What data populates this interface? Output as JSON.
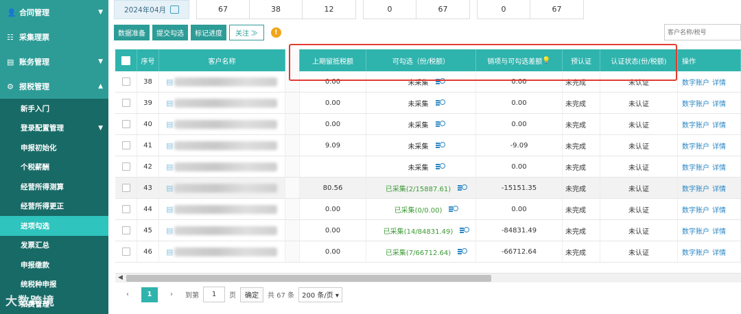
{
  "sidebar": {
    "top_items": [
      {
        "label": "合同管理",
        "icon": "person-icon",
        "chevron": "▼"
      },
      {
        "label": "采集理票",
        "icon": "list-icon",
        "chevron": ""
      },
      {
        "label": "账务管理",
        "icon": "ledger-icon",
        "chevron": "▼"
      },
      {
        "label": "报税管理",
        "icon": "tax-icon",
        "chevron": "▲"
      }
    ],
    "sub_items": [
      {
        "label": "新手入门"
      },
      {
        "label": "登录配置管理",
        "chevron": "▼"
      },
      {
        "label": "申报初始化"
      },
      {
        "label": "个税薪酬"
      },
      {
        "label": "经营所得测算"
      },
      {
        "label": "经营所得更正"
      },
      {
        "label": "进项勾选",
        "active": true
      },
      {
        "label": "发票汇总"
      },
      {
        "label": "申报缴款"
      },
      {
        "label": "统税种申报"
      },
      {
        "label": "扣费管理"
      }
    ],
    "watermark": "大数跨境"
  },
  "stats": {
    "date": "2024年04月",
    "group1": [
      "67",
      "38",
      "12"
    ],
    "group2": [
      "0",
      "67"
    ],
    "group3": [
      "0",
      "67"
    ]
  },
  "toolbar": {
    "buttons": [
      "数据准备",
      "提交勾选",
      "标记进度"
    ],
    "follow_label": "关注 ≫",
    "info": "!"
  },
  "search": {
    "placeholder": "客户名称/税号"
  },
  "table": {
    "headers": [
      "序号",
      "客户名称",
      "上期留抵税额",
      "可勾选（份/税额）",
      "销项与可勾选差额",
      "预认证",
      "认证状态(份/税额)",
      "操作"
    ],
    "rows": [
      {
        "no": "38",
        "prior": "0.00",
        "selectable": "未采集",
        "diff": "0.00",
        "pre": "未完成",
        "status": "未认证",
        "green": false
      },
      {
        "no": "39",
        "prior": "0.00",
        "selectable": "未采集",
        "diff": "0.00",
        "pre": "未完成",
        "status": "未认证",
        "green": false
      },
      {
        "no": "40",
        "prior": "0.00",
        "selectable": "未采集",
        "diff": "0.00",
        "pre": "未完成",
        "status": "未认证",
        "green": false
      },
      {
        "no": "41",
        "prior": "9.09",
        "selectable": "未采集",
        "diff": "-9.09",
        "pre": "未完成",
        "status": "未认证",
        "green": false
      },
      {
        "no": "42",
        "prior": "",
        "selectable": "未采集",
        "diff": "0.00",
        "pre": "未完成",
        "status": "未认证",
        "green": false
      },
      {
        "no": "43",
        "prior": "80.56",
        "selectable": "已采集(2/15887.61)",
        "diff": "-15151.35",
        "pre": "未完成",
        "status": "未认证",
        "green": true
      },
      {
        "no": "44",
        "prior": "0.00",
        "selectable": "已采集(0/0.00)",
        "diff": "0.00",
        "pre": "未完成",
        "status": "未认证",
        "green": true
      },
      {
        "no": "45",
        "prior": "0.00",
        "selectable": "已采集(14/84831.49)",
        "diff": "-84831.49",
        "pre": "未完成",
        "status": "未认证",
        "green": true
      },
      {
        "no": "46",
        "prior": "0.00",
        "selectable": "已采集(7/66712.64)",
        "diff": "-66712.64",
        "pre": "未完成",
        "status": "未认证",
        "green": true
      }
    ],
    "action_link_1": "数字账户",
    "action_link_2": "详情"
  },
  "pager": {
    "current": "1",
    "goto_label": "到第",
    "page_input": "1",
    "page_unit": "页",
    "confirm": "确定",
    "total": "共 67 条",
    "page_size": "200 条/页 ▾"
  },
  "colors": {
    "sidebar": "#2d9c97",
    "header": "#2fb3ad",
    "active": "#2fc4bd",
    "highlight_box": "#e03a2f"
  }
}
